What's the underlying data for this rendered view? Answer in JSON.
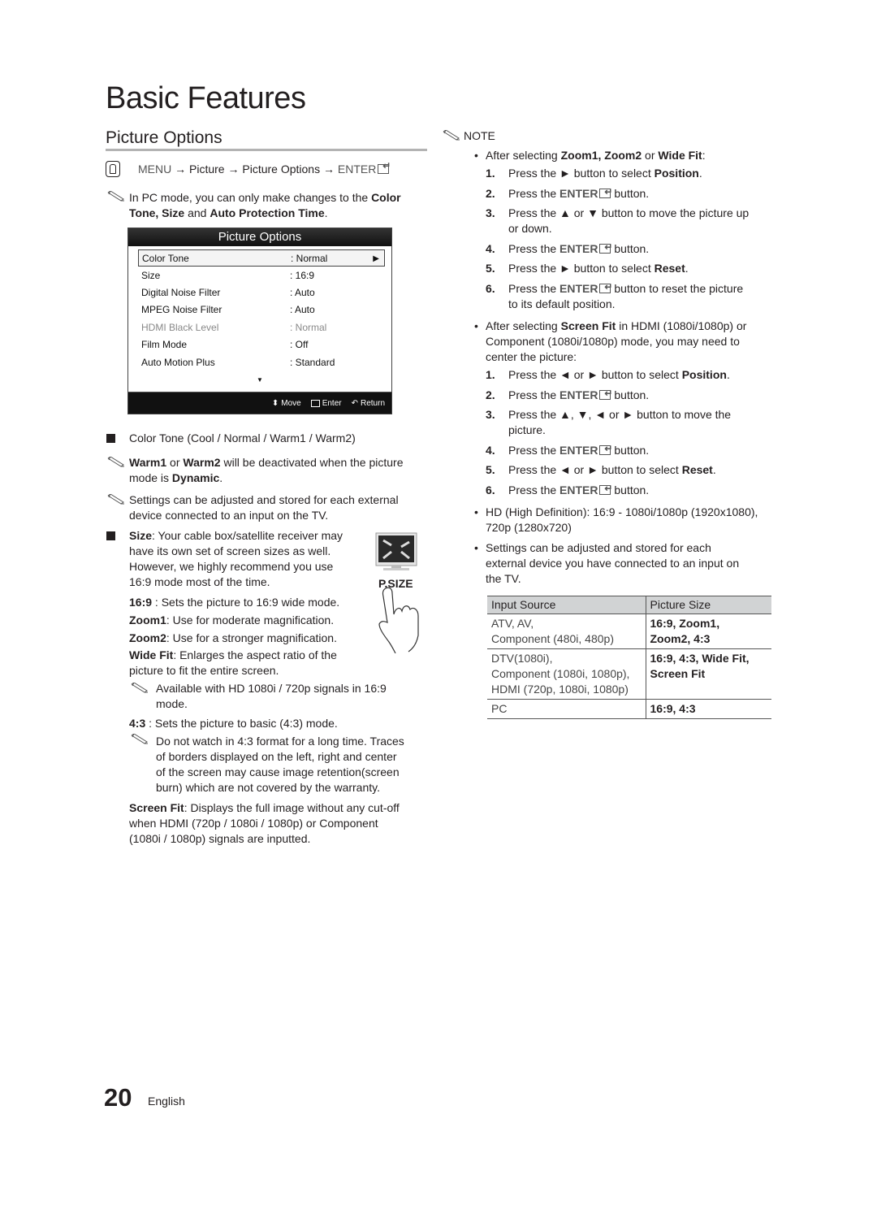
{
  "page": {
    "title": "Basic Features",
    "section_title": "Picture Options",
    "page_number": "20",
    "language": "English"
  },
  "menu_path": {
    "icon": "remote-hand-icon",
    "menu": "MENU",
    "arrow": "→",
    "picture": "Picture",
    "picture_options": "Picture Options",
    "enter": "ENTER"
  },
  "pc_note": {
    "pre": "In PC mode, you can only make changes to the ",
    "b1": "Color Tone, Size",
    "mid": " and ",
    "b2": "Auto Protection Time",
    "post": "."
  },
  "osd": {
    "title": "Picture Options",
    "rows": [
      {
        "label": "Color Tone",
        "value": ": Normal",
        "selected": true,
        "disabled": false
      },
      {
        "label": "Size",
        "value": ": 16:9",
        "selected": false,
        "disabled": false
      },
      {
        "label": "Digital Noise Filter",
        "value": ": Auto",
        "selected": false,
        "disabled": false
      },
      {
        "label": "MPEG Noise Filter",
        "value": ": Auto",
        "selected": false,
        "disabled": false
      },
      {
        "label": "HDMI Black Level",
        "value": ": Normal",
        "selected": false,
        "disabled": true
      },
      {
        "label": "Film Mode",
        "value": ": Off",
        "selected": false,
        "disabled": false
      },
      {
        "label": "Auto Motion Plus",
        "value": ": Standard",
        "selected": false,
        "disabled": false
      }
    ],
    "footer": {
      "move": "Move",
      "enter": "Enter",
      "return": "Return"
    }
  },
  "color_tone": {
    "heading": "Color Tone (Cool / Normal / Warm1 / Warm2)",
    "note1": {
      "b1": "Warm1",
      "mid1": " or ",
      "b2": "Warm2",
      "mid2": " will be deactivated when the picture",
      "line2_pre": "mode is ",
      "b3": "Dynamic",
      "line2_post": "."
    },
    "note2_l1": "Settings can be adjusted and stored for each external",
    "note2_l2": "device connected to an input on the TV."
  },
  "size": {
    "label": "Size",
    "l1": ": Your cable box/satellite receiver may",
    "l2": "have its own set of screen sizes as well.",
    "l3": "However, we highly recommend you use",
    "l4": "16:9 mode most of the time.",
    "psize_label": "P.SIZE",
    "modes": [
      {
        "name": "16:9",
        "desc": " : Sets the picture to 16:9 wide mode."
      },
      {
        "name": "Zoom1",
        "desc": ": Use for moderate magnification."
      },
      {
        "name": "Zoom2",
        "desc": ": Use for a stronger magnification."
      },
      {
        "name": "Wide Fit",
        "desc": ": Enlarges the aspect ratio of the"
      }
    ],
    "widefit_l2": "picture to fit the entire screen.",
    "hd_note_l1": "Available with HD 1080i / 720p signals in 16:9",
    "hd_note_l2": "mode.",
    "m43_name": "4:3",
    "m43_desc": " : Sets the picture to basic (4:3) mode.",
    "warn_l1": "Do not watch in 4:3 format for a long time. Traces",
    "warn_l2": "of borders displayed on the left, right and center",
    "warn_l3": "of the screen may cause image retention(screen",
    "warn_l4": "burn) which are not covered by the warranty.",
    "screenfit_name": "Screen Fit",
    "screenfit_l1": ": Displays the full image without any cut-off",
    "screenfit_l2": "when HDMI (720p / 1080i / 1080p) or Component",
    "screenfit_l3": "(1080i / 1080p) signals are inputted."
  },
  "note": {
    "heading": "NOTE",
    "b1": {
      "pre": "After selecting ",
      "bold": "Zoom1, Zoom2",
      "mid": " or ",
      "bold2": "Wide Fit",
      "post": ":",
      "steps": [
        {
          "n": "1.",
          "pre": "Press the ► button to select ",
          "bold": "Position",
          "post": "."
        },
        {
          "n": "2.",
          "pre": "Press the ",
          "enter": "ENTER",
          "post": " button."
        },
        {
          "n": "3.",
          "pre": "Press the ▲ or ▼ button to move the picture up",
          "line2": "or down."
        },
        {
          "n": "4.",
          "pre": "Press the ",
          "enter": "ENTER",
          "post": " button."
        },
        {
          "n": "5.",
          "pre": "Press the ► button to select ",
          "bold": "Reset",
          "post": "."
        },
        {
          "n": "6.",
          "pre": "Press the ",
          "enter": "ENTER",
          "post": " button to reset the picture",
          "line2": "to its default position."
        }
      ]
    },
    "b2": {
      "l1_pre": "After selecting ",
      "l1_bold": "Screen Fit",
      "l1_post": " in HDMI (1080i/1080p) or",
      "l2": "Component (1080i/1080p) mode, you may need to",
      "l3": "center the picture:",
      "steps": [
        {
          "n": "1.",
          "pre": "Press the ◄ or ► button to select ",
          "bold": "Position",
          "post": "."
        },
        {
          "n": "2.",
          "pre": "Press the ",
          "enter": "ENTER",
          "post": " button."
        },
        {
          "n": "3.",
          "pre": "Press the ▲, ▼, ◄ or ► button to move the",
          "line2": "picture."
        },
        {
          "n": "4.",
          "pre": "Press the ",
          "enter": "ENTER",
          "post": " button."
        },
        {
          "n": "5.",
          "pre": "Press the ◄ or ► button to select ",
          "bold": "Reset",
          "post": "."
        },
        {
          "n": "6.",
          "pre": "Press the ",
          "enter": "ENTER",
          "post": " button."
        }
      ]
    },
    "b3_l1": "HD (High Definition): 16:9 - 1080i/1080p (1920x1080),",
    "b3_l2": "720p (1280x720)",
    "b4_l1": "Settings can be adjusted and stored for each",
    "b4_l2": "external device you have connected to an input on",
    "b4_l3": "the TV."
  },
  "table": {
    "headers": [
      "Input Source",
      "Picture Size"
    ],
    "rows": [
      {
        "source": [
          "ATV, AV,",
          "Component (480i, 480p)"
        ],
        "size": [
          "16:9, Zoom1,",
          "Zoom2, 4:3"
        ]
      },
      {
        "source": [
          "DTV(1080i),",
          "Component (1080i, 1080p),",
          "HDMI (720p, 1080i, 1080p)"
        ],
        "size": [
          "16:9, 4:3, Wide Fit,",
          "Screen Fit"
        ]
      },
      {
        "source": [
          "PC"
        ],
        "size": [
          "16:9, 4:3"
        ]
      }
    ]
  }
}
